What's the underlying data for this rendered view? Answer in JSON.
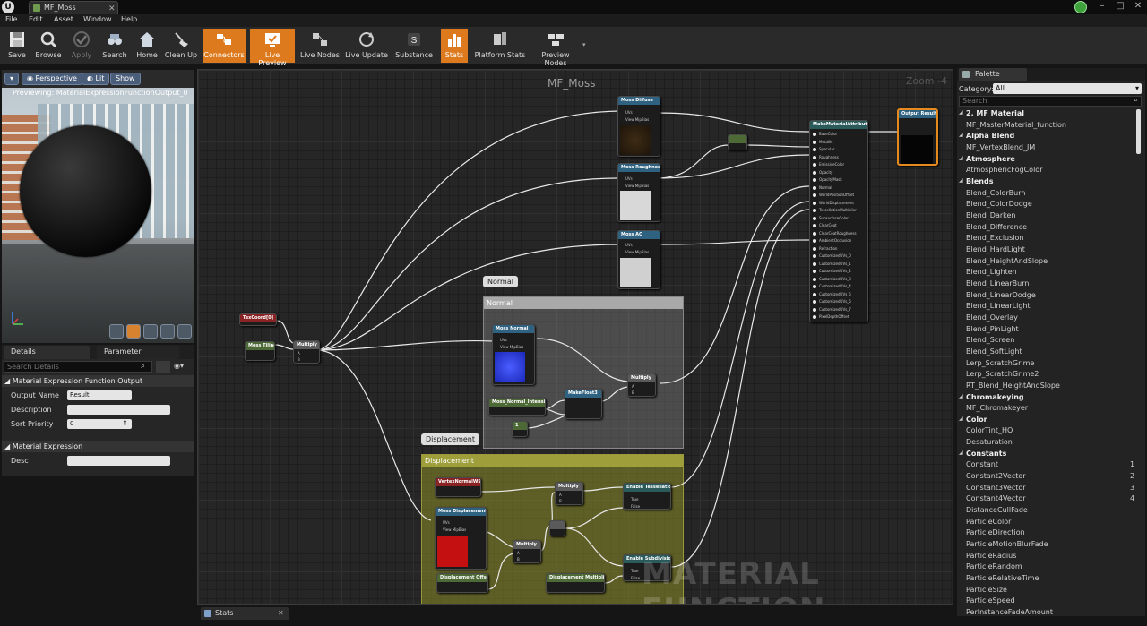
{
  "window": {
    "tab_title": "MF_Moss"
  },
  "menu": [
    "File",
    "Edit",
    "Asset",
    "Window",
    "Help"
  ],
  "toolbar": [
    {
      "label": "Save",
      "state": "normal"
    },
    {
      "label": "Browse",
      "state": "normal"
    },
    {
      "label": "Apply",
      "state": "disabled"
    },
    {
      "label": "Search",
      "state": "normal"
    },
    {
      "label": "Home",
      "state": "normal"
    },
    {
      "label": "Clean Up",
      "state": "normal"
    },
    {
      "label": "Connectors",
      "state": "on"
    },
    {
      "label": "Live Preview",
      "state": "on"
    },
    {
      "label": "Live Nodes",
      "state": "normal"
    },
    {
      "label": "Live Update",
      "state": "normal"
    },
    {
      "label": "Substance",
      "state": "normal"
    },
    {
      "label": "Stats",
      "state": "on"
    },
    {
      "label": "Platform Stats",
      "state": "normal"
    },
    {
      "label": "Preview Nodes",
      "state": "normal"
    }
  ],
  "viewport": {
    "perspective": "Perspective",
    "lit": "Lit",
    "show": "Show",
    "previewing": "Previewing: MaterialExpressionFunctionOutput_0"
  },
  "details": {
    "tabs": [
      "Details",
      "Parameter Defaults"
    ],
    "search_placeholder": "Search Details",
    "section1": "Material Expression Function Output",
    "output_name_label": "Output Name",
    "output_name_value": "Result",
    "description_label": "Description",
    "sort_priority_label": "Sort Priority",
    "sort_priority_value": "0",
    "section2": "Material Expression",
    "desc_label": "Desc"
  },
  "graph": {
    "title": "MF_Moss",
    "zoom": "Zoom -4",
    "watermark": "MATERIAL FUNCTION",
    "comment_normal": "Normal",
    "comment_displacement": "Displacement",
    "nodes": {
      "texcoord": "TexCoord[0]",
      "moss_tiling": "Moss Tiling",
      "multiply": "Multiply",
      "moss_diffuse": "Moss Diffuse",
      "moss_roughness": "Moss Roughness",
      "moss_ao": "Moss AO",
      "moss_normal": "Moss Normal",
      "normal_intensity": "Moss_Normal_Intensity",
      "makefloat3": "MakeFloat3",
      "const_one": "1",
      "make_attributes": "MakeMaterialAttributes",
      "output_result": "Output Result",
      "vertexnormal": "VertexNormalWS",
      "moss_displacement": "Moss Displacement",
      "displacement_offset": "Displacement Offset",
      "displacement_multiplier": "Displacement Multiplier",
      "enable_tessellation": "Enable Tessellation",
      "enable_subdivision": "Enable Subdivision"
    },
    "pins": {
      "uvs": "UVs",
      "view_mip": "View MipBias",
      "a": "A",
      "b": "B",
      "true": "True",
      "false": "False",
      "attr": [
        "BaseColor",
        "Metallic",
        "Specular",
        "Roughness",
        "EmissiveColor",
        "Opacity",
        "OpacityMask",
        "Normal",
        "WorldPositionOffset",
        "WorldDisplacement",
        "TessellationMultiplier",
        "SubsurfaceColor",
        "ClearCoat",
        "ClearCoatRoughness",
        "AmbientOcclusion",
        "Refraction",
        "CustomizedUVs_0",
        "CustomizedUVs_1",
        "CustomizedUVs_2",
        "CustomizedUVs_3",
        "CustomizedUVs_4",
        "CustomizedUVs_5",
        "CustomizedUVs_6",
        "CustomizedUVs_7",
        "PixelDepthOffset"
      ]
    }
  },
  "palette": {
    "title": "Palette",
    "category_label": "Category:",
    "category_value": "All",
    "search_placeholder": "Search",
    "entries": [
      {
        "type": "cat",
        "text": "2. MF Material"
      },
      {
        "type": "item",
        "text": "MF_MasterMaterial_function"
      },
      {
        "type": "cat",
        "text": "Alpha Blend"
      },
      {
        "type": "item",
        "text": "MF_VertexBlend_JM"
      },
      {
        "type": "cat",
        "text": "Atmosphere"
      },
      {
        "type": "item",
        "text": "AtmosphericFogColor"
      },
      {
        "type": "cat",
        "text": "Blends"
      },
      {
        "type": "item",
        "text": "Blend_ColorBurn"
      },
      {
        "type": "item",
        "text": "Blend_ColorDodge"
      },
      {
        "type": "item",
        "text": "Blend_Darken"
      },
      {
        "type": "item",
        "text": "Blend_Difference"
      },
      {
        "type": "item",
        "text": "Blend_Exclusion"
      },
      {
        "type": "item",
        "text": "Blend_HardLight"
      },
      {
        "type": "item",
        "text": "Blend_HeightAndSlope"
      },
      {
        "type": "item",
        "text": "Blend_Lighten"
      },
      {
        "type": "item",
        "text": "Blend_LinearBurn"
      },
      {
        "type": "item",
        "text": "Blend_LinearDodge"
      },
      {
        "type": "item",
        "text": "Blend_LinearLight"
      },
      {
        "type": "item",
        "text": "Blend_Overlay"
      },
      {
        "type": "item",
        "text": "Blend_PinLight"
      },
      {
        "type": "item",
        "text": "Blend_Screen"
      },
      {
        "type": "item",
        "text": "Blend_SoftLight"
      },
      {
        "type": "item",
        "text": "Lerp_ScratchGrime"
      },
      {
        "type": "item",
        "text": "Lerp_ScratchGrime2"
      },
      {
        "type": "item",
        "text": "RT_Blend_HeightAndSlope"
      },
      {
        "type": "cat",
        "text": "Chromakeying"
      },
      {
        "type": "item",
        "text": "MF_Chromakeyer"
      },
      {
        "type": "cat",
        "text": "Color"
      },
      {
        "type": "item",
        "text": "ColorTint_HQ"
      },
      {
        "type": "item",
        "text": "Desaturation"
      },
      {
        "type": "cat",
        "text": "Constants"
      },
      {
        "type": "item",
        "text": "Constant",
        "num": "1"
      },
      {
        "type": "item",
        "text": "Constant2Vector",
        "num": "2"
      },
      {
        "type": "item",
        "text": "Constant3Vector",
        "num": "3"
      },
      {
        "type": "item",
        "text": "Constant4Vector",
        "num": "4"
      },
      {
        "type": "item",
        "text": "DistanceCullFade"
      },
      {
        "type": "item",
        "text": "ParticleColor"
      },
      {
        "type": "item",
        "text": "ParticleDirection"
      },
      {
        "type": "item",
        "text": "ParticleMotionBlurFade"
      },
      {
        "type": "item",
        "text": "ParticleRadius"
      },
      {
        "type": "item",
        "text": "ParticleRandom"
      },
      {
        "type": "item",
        "text": "ParticleRelativeTime"
      },
      {
        "type": "item",
        "text": "ParticleSize"
      },
      {
        "type": "item",
        "text": "ParticleSpeed"
      },
      {
        "type": "item",
        "text": "PerInstanceFadeAmount"
      }
    ]
  },
  "bottom": {
    "stats_tab": "Stats"
  }
}
